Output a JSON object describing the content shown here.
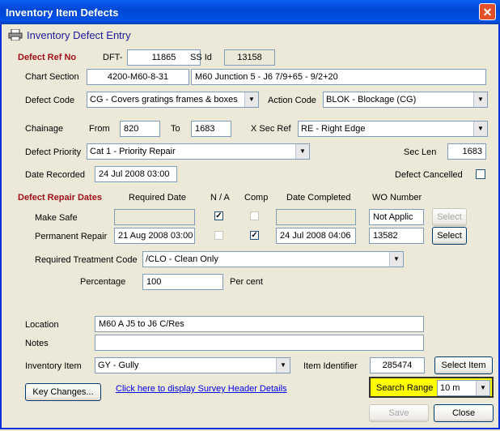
{
  "window": {
    "title": "Inventory Item Defects",
    "close_label": "✕"
  },
  "header": {
    "icon": "printer-icon",
    "title": "Inventory Defect Entry"
  },
  "defect_ref": {
    "heading": "Defect Ref No",
    "dft_label": "DFT-",
    "dft_value": "11865",
    "ssid_label": "SS Id",
    "ssid_value": "13158"
  },
  "chart_section": {
    "label": "Chart Section",
    "code": "4200-M60-8-31",
    "desc": "M60 Junction 5 - J6  7/9+65 - 9/2+20"
  },
  "defect_code": {
    "label": "Defect Code",
    "value": "CG - Covers gratings frames & boxes"
  },
  "action_code": {
    "label": "Action Code",
    "value": "BLOK - Blockage (CG)"
  },
  "chainage": {
    "label": "Chainage",
    "from_label": "From",
    "from_value": "820",
    "to_label": "To",
    "to_value": "1683"
  },
  "xsec": {
    "label": "X Sec Ref",
    "value": "RE - Right Edge"
  },
  "priority": {
    "label": "Defect Priority",
    "value": "Cat 1 - Priority Repair"
  },
  "sec_len": {
    "label": "Sec Len",
    "value": "1683"
  },
  "date_recorded": {
    "label": "Date Recorded",
    "value": "24 Jul 2008 03:00"
  },
  "defect_cancelled": {
    "label": "Defect Cancelled"
  },
  "repair": {
    "heading": "Defect Repair Dates",
    "col_required": "Required Date",
    "col_na": "N / A",
    "col_comp": "Comp",
    "col_completed": "Date Completed",
    "col_wo": "WO Number",
    "make_safe": {
      "label": "Make Safe",
      "required": "",
      "na": "✓",
      "comp": "",
      "completed": "",
      "wo": "Not Applic",
      "select": "Select"
    },
    "permanent": {
      "label": "Permanent Repair",
      "required": "21 Aug 2008 03:00",
      "na": "",
      "comp": "✓",
      "completed": "24 Jul 2008 04:06",
      "wo": "13582",
      "select": "Select"
    }
  },
  "treatment": {
    "label": "Required Treatment Code",
    "value": "/CLO - Clean Only"
  },
  "percentage": {
    "label": "Percentage",
    "value": "100",
    "unit": "Per cent"
  },
  "location": {
    "label": "Location",
    "value": "M60 A J5 to J6 C/Res"
  },
  "notes": {
    "label": "Notes",
    "value": ""
  },
  "inventory_item": {
    "label": "Inventory Item",
    "value": "GY - Gully"
  },
  "item_identifier": {
    "label": "Item Identifier",
    "value": "285474",
    "select_label": "Select Item"
  },
  "footer": {
    "key_changes": "Key Changes...",
    "survey_link": "Click here to display Survey Header Details",
    "search_range_label": "Search Range",
    "search_range_value": "10 m",
    "save": "Save",
    "close": "Close"
  }
}
